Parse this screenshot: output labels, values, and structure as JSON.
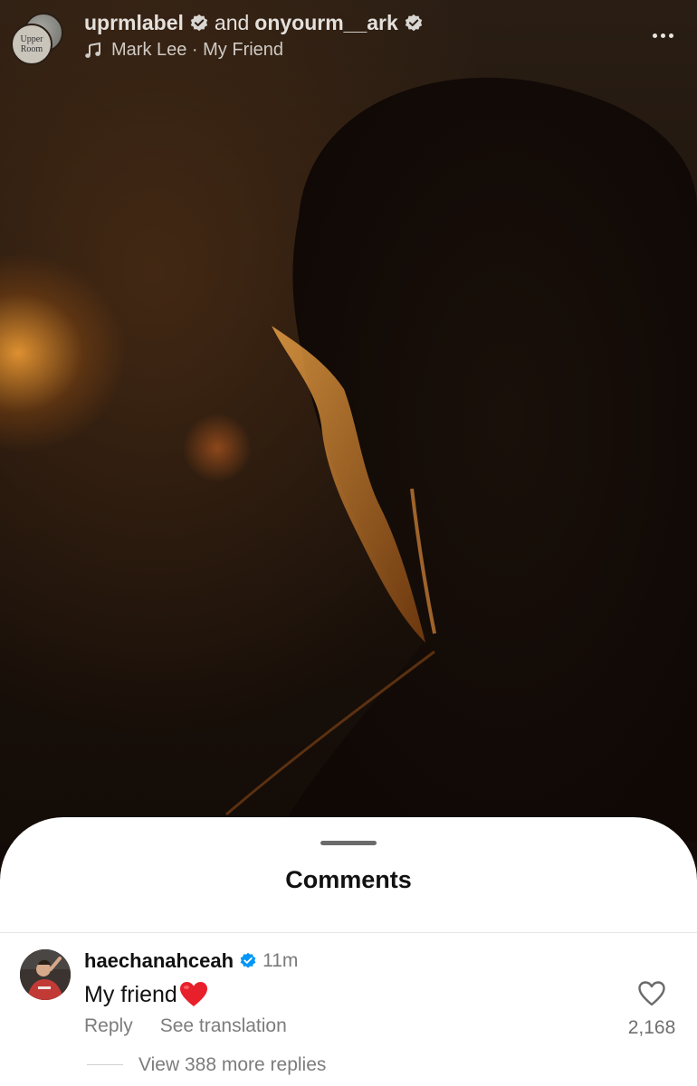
{
  "header": {
    "user_primary": "uprmlabel",
    "conjunction": "and",
    "user_secondary": "onyourm__ark",
    "avatar_text_line1": "Upper",
    "avatar_text_line2": "Room",
    "music_label": "Mark Lee · My Friend",
    "music_icon": "music-note-icon",
    "more_icon": "more-horizontal-icon"
  },
  "comments": {
    "title": "Comments",
    "items": [
      {
        "username": "haechanahceah",
        "verified": true,
        "time": "11m",
        "text": "My friend",
        "emoji": "red-heart",
        "reply_label": "Reply",
        "translate_label": "See translation",
        "like_count": "2,168",
        "view_replies_label": "View 388 more replies"
      }
    ]
  },
  "colors": {
    "verified_badge_dark": "#d9d6d2",
    "verified_badge_blue": "#0095f6",
    "heart_red": "#e0245e",
    "sheet_background": "#ffffff"
  }
}
